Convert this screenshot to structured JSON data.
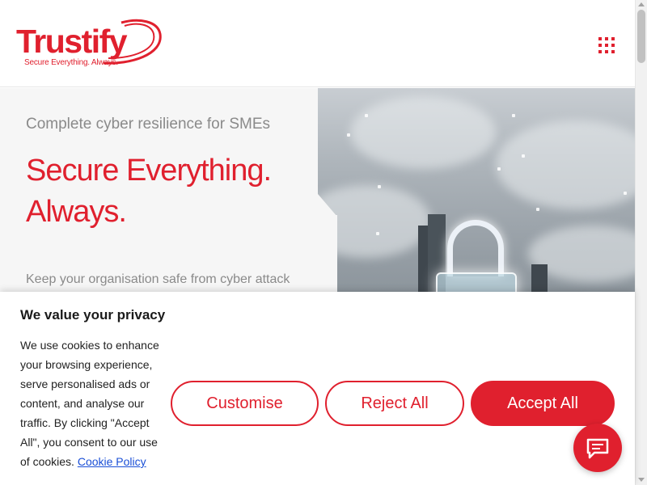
{
  "header": {
    "logo_word": "Trustify",
    "logo_tagline": "Secure Everything. Always.",
    "menu_icon": "grid-menu-icon"
  },
  "hero": {
    "subtitle": "Complete cyber resilience for SMEs",
    "title_line1": "Secure Everything.",
    "title_line2": "Always.",
    "body": "Keep your organisation safe from cyber attack"
  },
  "cookie_banner": {
    "title": "We value your privacy",
    "text": "We use cookies to enhance your browsing experience, serve personalised ads or content, and analyse our traffic. By clicking \"Accept All\", you consent to our use of cookies.",
    "policy_link": "Cookie Policy",
    "customise_label": "Customise",
    "reject_label": "Reject All",
    "accept_label": "Accept All"
  },
  "chat": {
    "icon": "chat-bubble-icon"
  },
  "colors": {
    "brand": "#e0202e",
    "link": "#1a4fd6"
  }
}
